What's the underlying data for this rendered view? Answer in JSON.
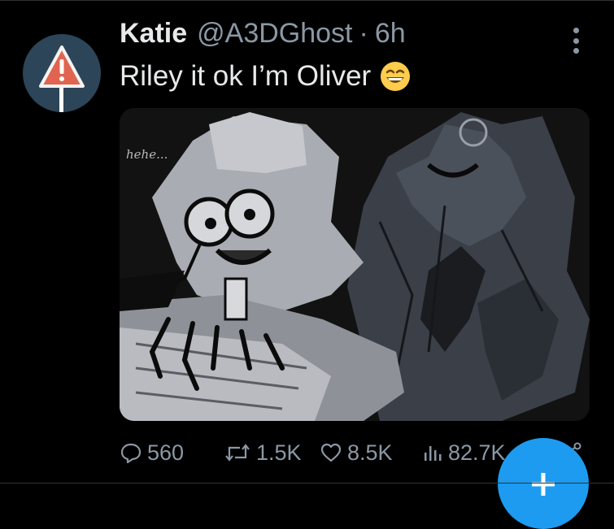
{
  "tweet": {
    "author_name": "Katie",
    "author_handle": "@A3DGhost",
    "separator": "·",
    "time_ago": "6h",
    "text": "Riley it ok I’m Oliver",
    "media": {
      "caption": "hehe..."
    }
  },
  "actions": {
    "replies": "560",
    "reposts": "1.5K",
    "likes": "8.5K",
    "views": "82.7K"
  },
  "icons": {
    "avatar": "warning-sign-icon",
    "more": "more-vertical-icon",
    "reply": "reply-icon",
    "repost": "repost-icon",
    "like": "heart-icon",
    "views": "views-icon",
    "share": "share-icon",
    "compose": "plus-icon"
  },
  "colors": {
    "background": "#000000",
    "text": "#e7e9ea",
    "muted": "#8b98a5",
    "accent": "#1d9bf0",
    "avatar_bg": "#2d4558",
    "warning": "#e0644f"
  }
}
